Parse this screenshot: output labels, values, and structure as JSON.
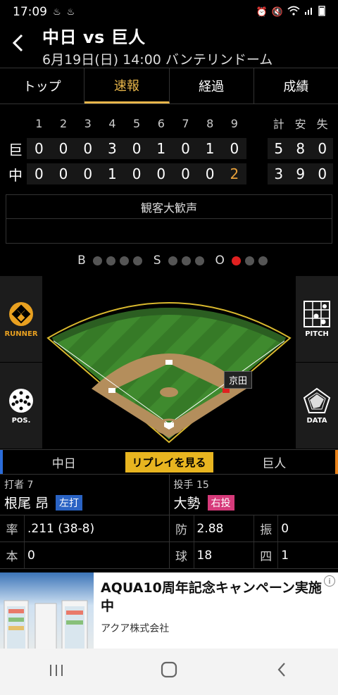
{
  "status": {
    "time": "17:09"
  },
  "header": {
    "title": "中日 vs 巨人",
    "subtitle": "6月19日(日) 14:00 バンテリンドーム"
  },
  "tabs": [
    {
      "label": "トップ"
    },
    {
      "label": "速報"
    },
    {
      "label": "経過"
    },
    {
      "label": "成績"
    }
  ],
  "scoreboard": {
    "innings": [
      "1",
      "2",
      "3",
      "4",
      "5",
      "6",
      "7",
      "8",
      "9"
    ],
    "totals_head": [
      "計",
      "安",
      "失"
    ],
    "teams": [
      {
        "abbr": "巨",
        "scores": [
          "0",
          "0",
          "0",
          "3",
          "0",
          "1",
          "0",
          "1",
          "0"
        ],
        "totals": [
          "5",
          "8",
          "0"
        ]
      },
      {
        "abbr": "中",
        "scores": [
          "0",
          "0",
          "0",
          "1",
          "0",
          "0",
          "0",
          "0",
          "2"
        ],
        "totals": [
          "3",
          "9",
          "0"
        ]
      }
    ]
  },
  "messages": {
    "line1": "観客大歓声",
    "line2": ""
  },
  "count": {
    "b": "B",
    "s": "S",
    "o": "O",
    "balls": 0,
    "strikes": 0,
    "outs": 1
  },
  "side_buttons": {
    "runner": "RUNNER",
    "pos": "POS.",
    "pitch": "PITCH",
    "data": "DATA"
  },
  "runner_label": "京田",
  "team_bar": {
    "left": "中日",
    "replay": "リプレイを見る",
    "right": "巨人"
  },
  "batter": {
    "role": "打者 7",
    "name": "根尾 昂",
    "hand": "左打"
  },
  "pitcher": {
    "role": "投手 15",
    "name": "大勢",
    "hand": "右投"
  },
  "batter_stats": [
    {
      "k": "率",
      "v": ".211 (38-8)"
    },
    {
      "k": "本",
      "v": "0"
    }
  ],
  "pitcher_stats": [
    {
      "k": "防",
      "v": "2.88",
      "k2": "振",
      "v2": "0"
    },
    {
      "k": "球",
      "v": "18",
      "k2": "四",
      "v2": "1"
    }
  ],
  "ad": {
    "title": "AQUA10周年記念キャンペーン実施中",
    "company": "アクア株式会社"
  }
}
